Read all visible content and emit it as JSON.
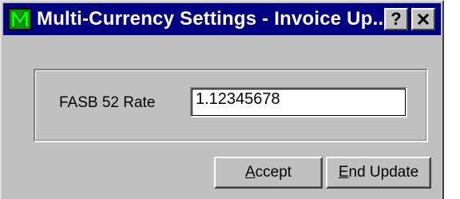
{
  "window": {
    "title": "Multi-Currency Settings - Invoice Up...",
    "help_button": "?",
    "close_button": "close"
  },
  "form": {
    "rate_label": "FASB 52 Rate",
    "rate_value": "1.12345678"
  },
  "buttons": {
    "accept": {
      "mnemonic": "A",
      "rest": "ccept"
    },
    "end_update": {
      "mnemonic": "E",
      "rest": "nd Update"
    }
  },
  "colors": {
    "titlebar": "#000080",
    "face": "#c0c0c0",
    "icon_green": "#00ff00"
  },
  "icons": {
    "app": "app-logo-m-icon",
    "help": "help-question-icon",
    "close": "close-x-icon"
  }
}
